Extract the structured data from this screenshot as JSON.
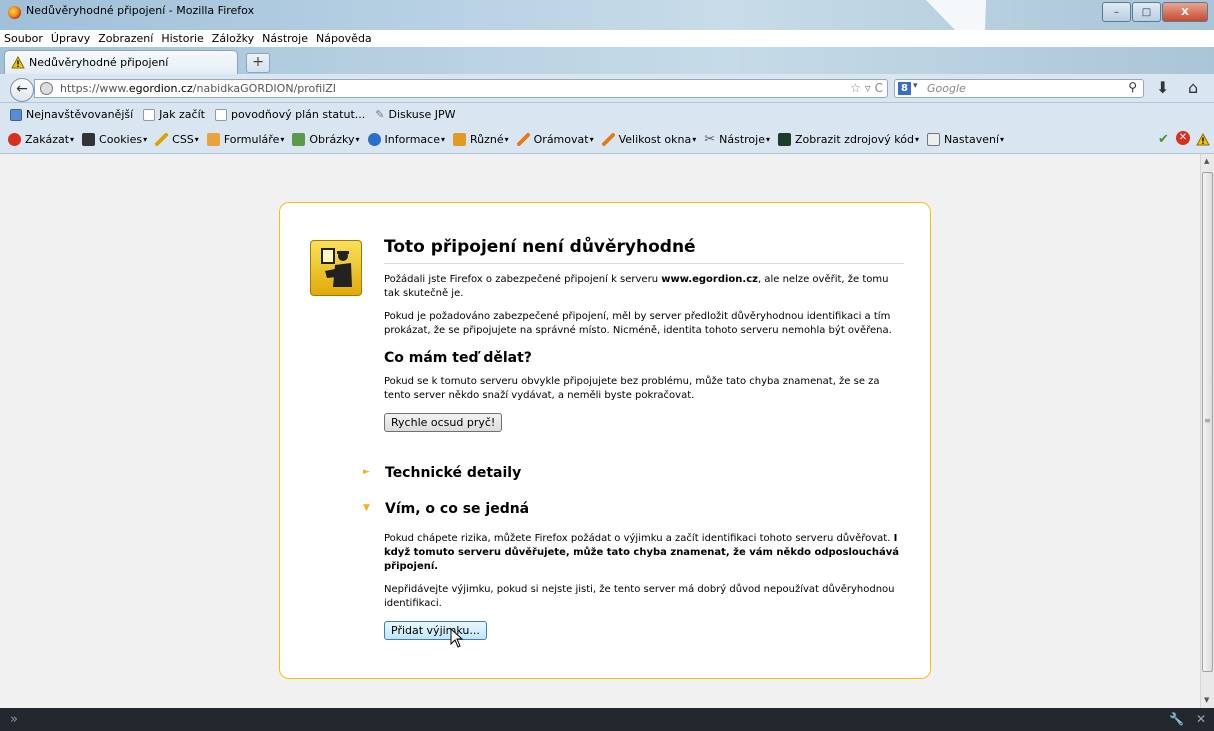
{
  "window": {
    "title": "Nedůvěryhodné připojení - Mozilla Firefox",
    "minimize": "–",
    "maximize": "□",
    "close": "X"
  },
  "menu": [
    "Soubor",
    "Úpravy",
    "Zobrazení",
    "Historie",
    "Záložky",
    "Nástroje",
    "Nápověda"
  ],
  "tab": {
    "title": "Nedůvěryhodné připojení",
    "new_tab": "+"
  },
  "nav": {
    "url_prefix": "https://www.",
    "url_host": "egordion.cz",
    "url_path": "/nabidkaGORDION/profilZI",
    "search_placeholder": "Google"
  },
  "bookmarks": [
    "Nejnavštěvovanější",
    "Jak začít",
    "povodňový plán statut...",
    "Diskuse JPW"
  ],
  "devbar": [
    "Zakázat",
    "Cookies",
    "CSS",
    "Formuláře",
    "Obrázky",
    "Informace",
    "Různé",
    "Orámovat",
    "Velikost okna",
    "Nástroje",
    "Zobrazit zdrojový kód",
    "Nastavení"
  ],
  "error": {
    "title": "Toto připojení není důvěryhodné",
    "p1a": "Požádali jste Firefox o zabezpečené připojení k serveru ",
    "p1host": "www.egordion.cz",
    "p1b": ", ale nelze ověřit, že tomu tak skutečně je.",
    "p2": "Pokud je požadováno zabezpečené připojení, měl by server předložit důvěryhodnou identifikaci a tím prokázat, že se připojujete na správné místo. Nicméně, identita tohoto serveru nemohla být ověřena.",
    "h_what": "Co mám teď dělat?",
    "p3": "Pokud se k tomuto serveru obvykle připojujete bez problému, může tato chyba znamenat, že se za tento server někdo snaží vydávat, a neměli byste pokračovat.",
    "btn_leave": "Rychle ocsud pryč!",
    "tech_details": "Technické detaily",
    "understand": "Vím, o co se jedná",
    "p4a": "Pokud chápete rizika, můžete Firefox požádat o výjimku a začít identifikaci tohoto serveru důvěřovat. ",
    "p4b": "I když tomuto serveru důvěřujete, může tato chyba znamenat, že vám někdo odposlouchává připojení.",
    "p5": "Nepřidávejte výjimku, pokud si nejste jisti, že tento server má dobrý důvod nepoužívat důvěryhodnou identifikaci.",
    "btn_add": "Přidat výjimku..."
  },
  "colors": {
    "accent": "#ffbd09",
    "arrow": "#ffab1a"
  }
}
